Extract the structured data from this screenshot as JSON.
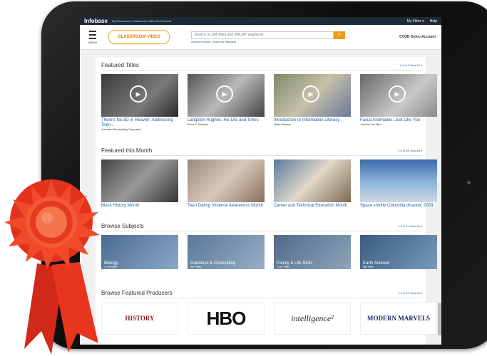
{
  "topbar": {
    "brand": "Infobase",
    "crumbs": "My Resources > Classroom Video On Demand",
    "my_films": "My Films ▾",
    "help": "Help"
  },
  "header": {
    "menu_label": "MENU",
    "logo_text": "CLASSROOM VIDEO",
    "search_placeholder": "Search 31,000 titles and 308,387 segments",
    "search_links": "Advanced Search | Search by Standards",
    "account": "CVOD Demo Account"
  },
  "featured_titles": {
    "title": "Featured Titles",
    "count": "1-4 of 8  View All ▾",
    "items": [
      {
        "title": "There's No 3G in Heaven: Addressing Teen...",
        "sub": "Australian Broadcasting Corporation"
      },
      {
        "title": "Langston Hughes: His Life and Times",
        "sub": "Bruce R. Schwartz"
      },
      {
        "title": "Introduction to Information Literacy",
        "sub": "Motion Masters"
      },
      {
        "title": "Facial Anomalies: Just Like You",
        "sub": "Just Like You Films"
      }
    ]
  },
  "featured_month": {
    "title": "Featured this Month",
    "count": "1-4 of 65  View All ▾",
    "items": [
      {
        "title": "Black History Month"
      },
      {
        "title": "Teen Dating Violence Awareness Month"
      },
      {
        "title": "Career and Technical Education Month"
      },
      {
        "title": "Space shuttle Columbia disaster, 2003"
      }
    ]
  },
  "browse_subjects": {
    "title": "Browse Subjects",
    "count": "1-4 of 27  View All ▾",
    "items": [
      {
        "label": "Biology",
        "count": "1,736 Titles"
      },
      {
        "label": "Guidance & Counseling",
        "count": "537 Titles"
      },
      {
        "label": "Family & Life Skills",
        "count": "1,207 Titles"
      },
      {
        "label": "Earth Science",
        "count": "865 Titles"
      }
    ]
  },
  "browse_producers": {
    "title": "Browse Featured Producers",
    "count": "1-4 of 36  View All ▾",
    "items": [
      {
        "name": "HISTORY"
      },
      {
        "name": "HBO"
      },
      {
        "name": "intelligence²"
      },
      {
        "name": "MODERN MARVELS"
      }
    ]
  },
  "colors": {
    "accent_orange": "#f09a1a",
    "link_blue": "#1a5ea8",
    "ribbon_red": "#e8361e"
  }
}
